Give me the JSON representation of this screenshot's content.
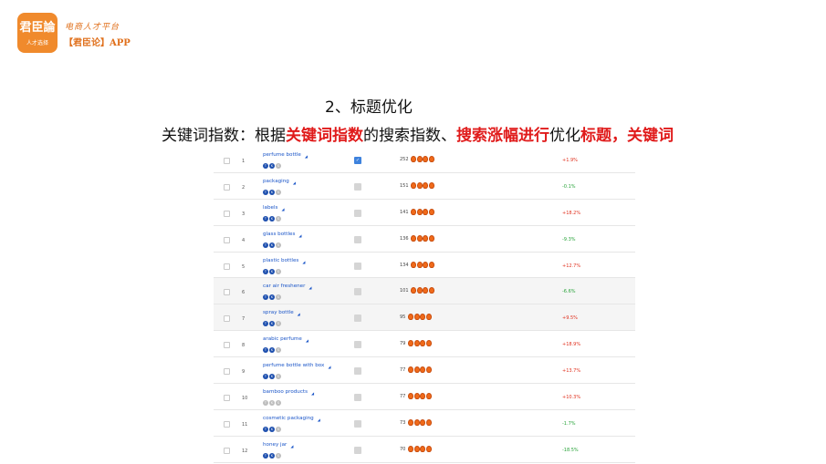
{
  "brand": {
    "logo_text": "君臣論",
    "logo_sub": "人才选择",
    "slogan": "电商人才平台",
    "app_tag": "【君臣论】APP"
  },
  "heading": {
    "section_title": "2、标题优化",
    "subtitle_parts": [
      {
        "text": "关键词指数：根据",
        "highlight": false
      },
      {
        "text": "关键词指数",
        "highlight": true
      },
      {
        "text": "的搜索指数、",
        "highlight": false
      },
      {
        "text": "搜索涨幅进行",
        "highlight": true
      },
      {
        "text": "优化",
        "highlight": false
      },
      {
        "text": "标题，关键词",
        "highlight": true
      }
    ]
  },
  "colors": {
    "accent": "#f08a2c",
    "highlight": "#e01b1b",
    "link": "#1a55c8",
    "up": "#e0301e",
    "down": "#29a33a"
  },
  "table": {
    "rows": [
      {
        "rank": "1",
        "keyword": "perfume bottle",
        "score": "252",
        "flames": 4,
        "trend": "+1.9%",
        "dir": "up",
        "active": true,
        "badge_gray": false
      },
      {
        "rank": "2",
        "keyword": "packaging",
        "score": "151",
        "flames": 4,
        "trend": "-0.1%",
        "dir": "down",
        "active": false,
        "badge_gray": false
      },
      {
        "rank": "3",
        "keyword": "labels",
        "score": "141",
        "flames": 4,
        "trend": "+18.2%",
        "dir": "up",
        "active": false,
        "badge_gray": false
      },
      {
        "rank": "4",
        "keyword": "glass bottles",
        "score": "136",
        "flames": 4,
        "trend": "-9.3%",
        "dir": "down",
        "active": false,
        "badge_gray": false
      },
      {
        "rank": "5",
        "keyword": "plastic bottles",
        "score": "134",
        "flames": 4,
        "trend": "+12.7%",
        "dir": "up",
        "active": false,
        "badge_gray": false
      },
      {
        "rank": "6",
        "keyword": "car air freshener",
        "score": "101",
        "flames": 4,
        "trend": "-6.6%",
        "dir": "down",
        "active": false,
        "badge_gray": false
      },
      {
        "rank": "7",
        "keyword": "spray bottle",
        "score": "95",
        "flames": 4,
        "trend": "+9.5%",
        "dir": "up",
        "active": false,
        "badge_gray": false
      },
      {
        "rank": "8",
        "keyword": "arabic perfume",
        "score": "79",
        "flames": 4,
        "trend": "+18.9%",
        "dir": "up",
        "active": false,
        "badge_gray": false
      },
      {
        "rank": "9",
        "keyword": "perfume bottle with box",
        "score": "77",
        "flames": 4,
        "trend": "+13.7%",
        "dir": "up",
        "active": false,
        "badge_gray": false
      },
      {
        "rank": "10",
        "keyword": "bamboo products",
        "score": "77",
        "flames": 4,
        "trend": "+10.3%",
        "dir": "up",
        "active": false,
        "badge_gray": true
      },
      {
        "rank": "11",
        "keyword": "cosmetic packaging",
        "score": "73",
        "flames": 4,
        "trend": "-1.7%",
        "dir": "down",
        "active": false,
        "badge_gray": false
      },
      {
        "rank": "12",
        "keyword": "honey jar",
        "score": "70",
        "flames": 4,
        "trend": "-18.5%",
        "dir": "down",
        "active": false,
        "badge_gray": false
      }
    ]
  }
}
